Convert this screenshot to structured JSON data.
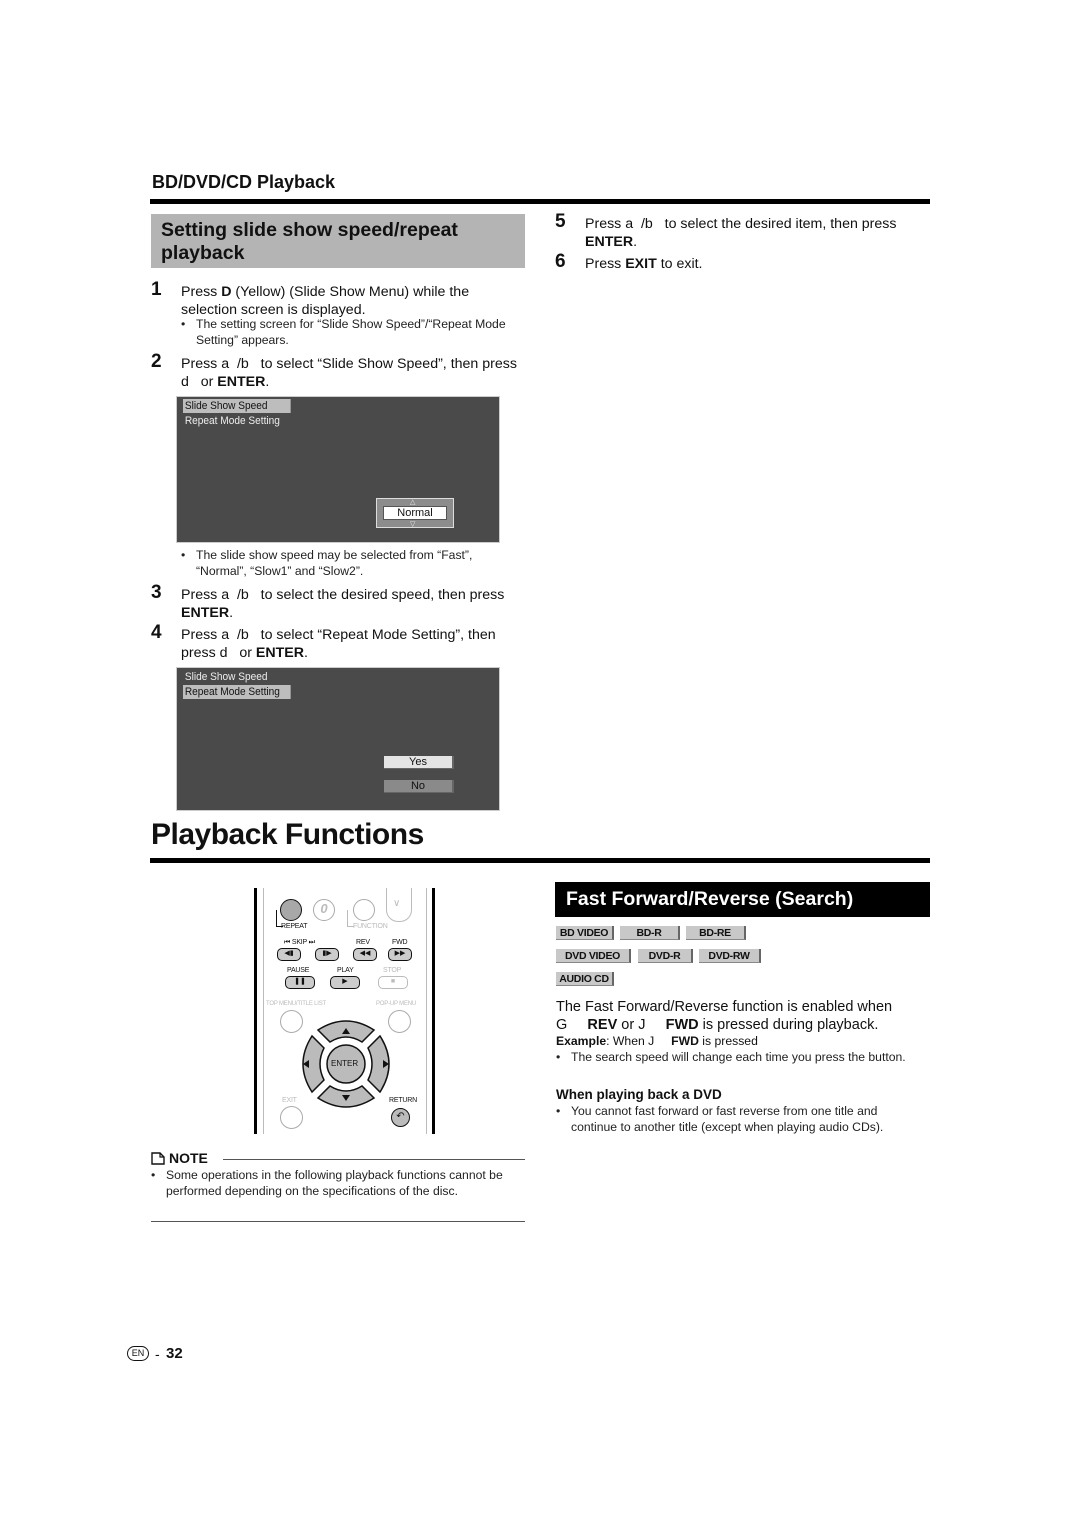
{
  "section_header": "BD/DVD/CD Playback",
  "subsection_title": "Setting slide show speed/repeat playback",
  "steps_left": [
    {
      "num": "1",
      "parts": [
        {
          "t": "Press "
        },
        {
          "t": "D",
          "b": true
        },
        {
          "t": " (Yellow) (Slide Show Menu) while the selection screen is displayed."
        }
      ]
    },
    {
      "num": "2",
      "parts": [
        {
          "t": "Press a  /b   to select “Slide Show Speed”, then press d   or "
        },
        {
          "t": "ENTER",
          "b": true
        },
        {
          "t": "."
        }
      ]
    },
    {
      "num": "3",
      "parts": [
        {
          "t": "Press a  /b   to select the desired speed, then press "
        },
        {
          "t": "ENTER",
          "b": true
        },
        {
          "t": "."
        }
      ]
    },
    {
      "num": "4",
      "parts": [
        {
          "t": "Press a  /b   to select “Repeat Mode Setting”, then press d   or "
        },
        {
          "t": "ENTER",
          "b": true
        },
        {
          "t": "."
        }
      ]
    }
  ],
  "step1_note": "The setting screen for “Slide Show Speed”/“Repeat Mode Setting” appears.",
  "screen1": {
    "menu": [
      "Slide Show Speed",
      "Repeat Mode Setting"
    ],
    "selected_index": 0,
    "value": "Normal"
  },
  "screen1_note": "The slide show speed may be selected from “Fast”, “Normal”, “Slow1” and “Slow2”.",
  "screen2": {
    "menu": [
      "Slide Show Speed",
      "Repeat Mode Setting"
    ],
    "selected_index": 1,
    "options": [
      "Yes",
      "No"
    ]
  },
  "steps_right": [
    {
      "num": "5",
      "parts": [
        {
          "t": "Press a  /b   to select the desired item, then press "
        },
        {
          "t": "ENTER",
          "b": true
        },
        {
          "t": "."
        }
      ]
    },
    {
      "num": "6",
      "parts": [
        {
          "t": "Press "
        },
        {
          "t": "EXIT",
          "b": true
        },
        {
          "t": " to exit."
        }
      ]
    }
  ],
  "main_title": "Playback Functions",
  "remote": {
    "repeat": "REPEAT",
    "zero": "0",
    "function": "FUNCTION",
    "skip": "SKIP",
    "rev": "REV",
    "fwd": "FWD",
    "pause": "PAUSE",
    "play": "PLAY",
    "stop": "STOP",
    "top_menu": "TOP MENU/TITLE LIST",
    "popup_menu": "POP-UP MENU",
    "enter": "ENTER",
    "exit": "EXIT",
    "return": "RETURN"
  },
  "note": {
    "label": "NOTE",
    "text": "Some operations in the following playback functions cannot be performed depending on the specifications of the disc."
  },
  "ff_section": {
    "title": "Fast Forward/Reverse (Search)",
    "badges_row1": [
      "BD VIDEO",
      "BD-R",
      "BD-RE"
    ],
    "badges_row2": [
      "DVD VIDEO",
      "DVD-R",
      "DVD-RW"
    ],
    "badges_row3": [
      "AUDIO CD"
    ],
    "para_line1": "The Fast Forward/Reverse function is enabled when",
    "para_line2_parts": [
      {
        "t": "G     "
      },
      {
        "t": "REV",
        "b": true
      },
      {
        "t": " or J     "
      },
      {
        "t": "FWD",
        "b": true
      },
      {
        "t": " is pressed during playback."
      }
    ],
    "example_parts": [
      {
        "t": "Example",
        "b": true
      },
      {
        "t": ": When J     "
      },
      {
        "t": "FWD",
        "b": true
      },
      {
        "t": " is pressed"
      }
    ],
    "bullet1": "The search speed will change each time you press the button.",
    "subheading": "When playing back a DVD",
    "bullet2": "You cannot fast forward or fast reverse from one title and continue to another title (except when playing audio CDs)."
  },
  "footer": {
    "lang": "EN",
    "sep": "-",
    "page": "32"
  }
}
